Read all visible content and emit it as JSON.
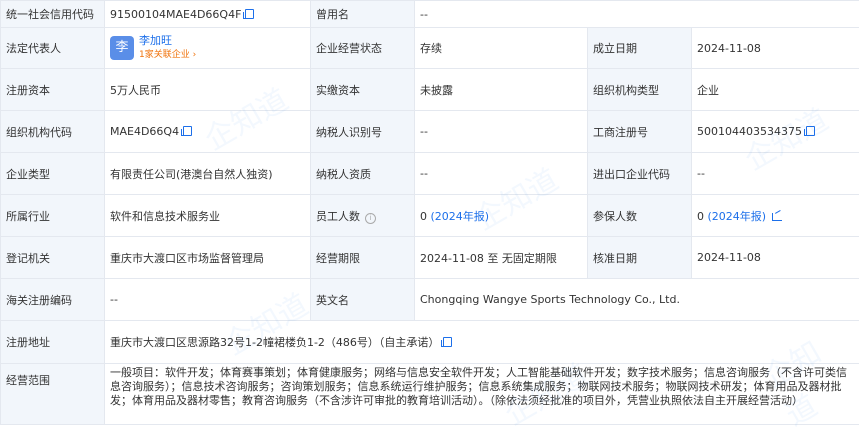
{
  "rows": {
    "r1": {
      "l1": "统一社会信用代码",
      "v1": "91500104MAE4D66Q4F",
      "l2": "曾用名",
      "v2": "--"
    },
    "r2": {
      "l1": "法定代表人",
      "person": {
        "avatar": "李",
        "name": "李加旺",
        "related": "1家关联企业 ›"
      },
      "l2": "企业经营状态",
      "v2": "存续",
      "l3": "成立日期",
      "v3": "2024-11-08"
    },
    "r3": {
      "l1": "注册资本",
      "v1": "5万人民币",
      "l2": "实缴资本",
      "v2": "未披露",
      "l3": "组织机构类型",
      "v3": "企业"
    },
    "r4": {
      "l1": "组织机构代码",
      "v1": "MAE4D66Q4",
      "l2": "纳税人识别号",
      "v2": "--",
      "l3": "工商注册号",
      "v3": "500104403534375"
    },
    "r5": {
      "l1": "企业类型",
      "v1": "有限责任公司(港澳台自然人独资)",
      "l2": "纳税人资质",
      "v2": "--",
      "l3": "进出口企业代码",
      "v3": "--"
    },
    "r6": {
      "l1": "所属行业",
      "v1": "软件和信息技术服务业",
      "l2": "员工人数",
      "v2_num": "0",
      "v2_link": "(2024年报)",
      "l3": "参保人数",
      "v3_num": "0",
      "v3_link": "(2024年报)"
    },
    "r7": {
      "l1": "登记机关",
      "v1": "重庆市大渡口区市场监督管理局",
      "l2": "经营期限",
      "v2": "2024-11-08 至 无固定期限",
      "l3": "核准日期",
      "v3": "2024-11-08"
    },
    "r8": {
      "l1": "海关注册编码",
      "v1": "--",
      "l2": "英文名",
      "v2": "Chongqing Wangye Sports Technology Co., Ltd."
    },
    "r9": {
      "l1": "注册地址",
      "v1": "重庆市大渡口区思源路32号1-2幢裙楼负1-2（486号）（自主承诺）"
    },
    "r10": {
      "l1": "经营范围",
      "v1": "一般项目：软件开发；体育赛事策划；体育健康服务；网络与信息安全软件开发；人工智能基础软件开发；数字技术服务；信息咨询服务（不含许可类信息咨询服务）；信息技术咨询服务；咨询策划服务；信息系统运行维护服务；信息系统集成服务；物联网技术服务；物联网技术研发；体育用品及器材批发；体育用品及器材零售；教育咨询服务（不含涉许可审批的教育培训活动）。（除依法须经批准的项目外，凭营业执照依法自主开展经营活动）"
    }
  },
  "watermark": "企知道",
  "colors": {
    "label_bg": "#f2f6fb",
    "border": "#e4e8ef",
    "link": "#1c6fea",
    "orange": "#f0720b"
  }
}
